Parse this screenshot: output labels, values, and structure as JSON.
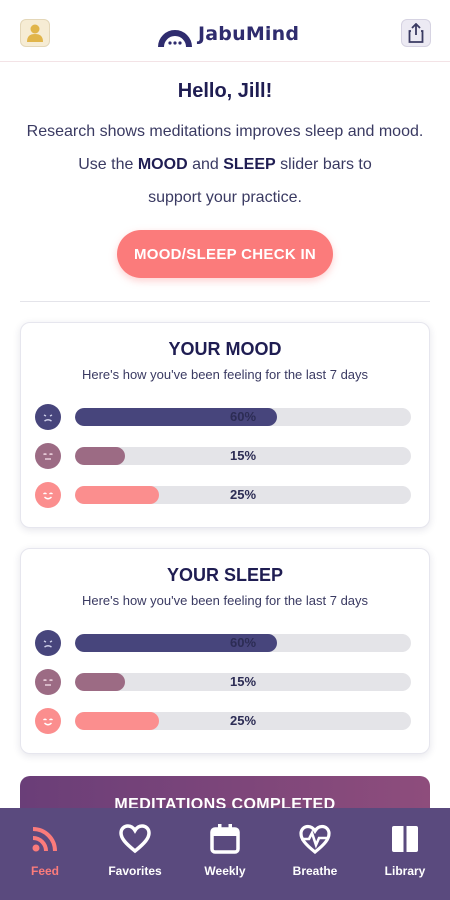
{
  "header": {
    "app_name": "JabuMind",
    "profile_icon": "person-icon",
    "share_icon": "share-icon"
  },
  "intro": {
    "greeting": "Hello, Jill!",
    "line1": "Research shows meditations improves sleep and mood.",
    "line2_pre": "Use the ",
    "line2_mood": "MOOD",
    "line2_mid": " and ",
    "line2_sleep": "SLEEP",
    "line2_post": " slider bars to",
    "line3": "support your practice."
  },
  "checkin_button": "MOOD/SLEEP CHECK IN",
  "mood": {
    "title": "YOUR MOOD",
    "subtitle": "Here's how you've been feeling for the last 7 days",
    "rows": [
      {
        "label": "60%",
        "value": 60,
        "icon": "sad-face-icon",
        "color": "#47457c"
      },
      {
        "label": "15%",
        "value": 15,
        "icon": "neutral-face-icon",
        "color": "#9c6b84"
      },
      {
        "label": "25%",
        "value": 25,
        "icon": "happy-face-icon",
        "color": "#fb8e8e"
      }
    ]
  },
  "sleep": {
    "title": "YOUR SLEEP",
    "subtitle": "Here's how you've been feeling for the last 7 days",
    "rows": [
      {
        "label": "60%",
        "value": 60,
        "icon": "sad-face-icon",
        "color": "#47457c"
      },
      {
        "label": "15%",
        "value": 15,
        "icon": "neutral-face-icon",
        "color": "#9c6b84"
      },
      {
        "label": "25%",
        "value": 25,
        "icon": "happy-face-icon",
        "color": "#fb8e8e"
      }
    ]
  },
  "meditations_banner": "MEDITATIONS COMPLETED",
  "tabs": [
    {
      "label": "Feed",
      "icon": "rss-feed-icon",
      "active": true
    },
    {
      "label": "Favorites",
      "icon": "heart-icon",
      "active": false
    },
    {
      "label": "Weekly",
      "icon": "calendar-icon",
      "active": false
    },
    {
      "label": "Breathe",
      "icon": "heartbeat-icon",
      "active": false
    },
    {
      "label": "Library",
      "icon": "book-icon",
      "active": false
    }
  ],
  "colors": {
    "accent": "#fb7b7b",
    "navy": "#47457c",
    "mauve": "#9c6b84",
    "tabbar": "#5a4a7e"
  }
}
